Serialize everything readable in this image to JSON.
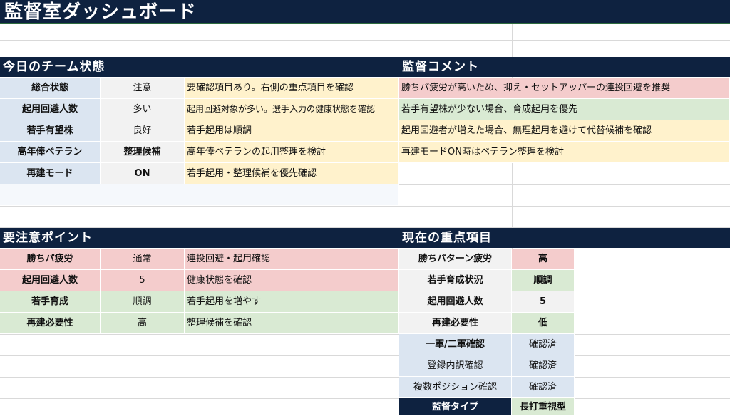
{
  "title": "監督室ダッシュボード",
  "colors": {
    "header_navy": "#0e2240",
    "pink": "#f4cccc",
    "green": "#d9ead3",
    "yellow": "#fff2cc",
    "light_blue": "#dbe5f1",
    "gray": "#f2f2f2"
  },
  "team_status": {
    "heading": "今日のチーム状態",
    "rows": [
      {
        "label": "総合状態",
        "value": "注意",
        "note": "要確認項目あり。右側の重点項目を確認"
      },
      {
        "label": "起用回避人数",
        "value": "多い",
        "note": "起用回避対象が多い。選手入力の健康状態を確認"
      },
      {
        "label": "若手有望株",
        "value": "良好",
        "note": "若手起用は順調"
      },
      {
        "label": "高年俸ベテラン",
        "value": "整理候補",
        "note": "高年俸ベテランの起用整理を検討"
      },
      {
        "label": "再建モード",
        "value": "ON",
        "note": "若手起用・整理候補を優先確認"
      }
    ]
  },
  "manager_comments": {
    "heading": "監督コメント",
    "items": [
      {
        "text": "勝ちパ疲労が高いため、抑え・セットアッパーの連投回避を推奨",
        "tone": "pink"
      },
      {
        "text": "若手有望株が少ない場合、育成起用を優先",
        "tone": "green"
      },
      {
        "text": "起用回避者が増えた場合、無理起用を避けて代替候補を確認",
        "tone": "yellow"
      },
      {
        "text": "再建モードON時はベテラン整理を検討",
        "tone": "yellow"
      }
    ]
  },
  "attention_points": {
    "heading": "要注意ポイント",
    "rows": [
      {
        "label": "勝ちパ疲労",
        "value": "通常",
        "note": "連投回避・起用確認",
        "tone": "pink"
      },
      {
        "label": "起用回避人数",
        "value": "5",
        "note": "健康状態を確認",
        "tone": "pink"
      },
      {
        "label": "若手育成",
        "value": "順調",
        "note": "若手起用を増やす",
        "tone": "green"
      },
      {
        "label": "再建必要性",
        "value": "高",
        "note": "整理候補を確認",
        "tone": "green"
      }
    ]
  },
  "focus_items": {
    "heading": "現在の重点項目",
    "rows": [
      {
        "label": "勝ちパターン疲労",
        "value": "高",
        "tone": "pink"
      },
      {
        "label": "若手育成状況",
        "value": "順調",
        "tone": "green"
      },
      {
        "label": "起用回避人数",
        "value": "5",
        "tone": "gray"
      },
      {
        "label": "再建必要性",
        "value": "低",
        "tone": "green"
      }
    ],
    "checks": [
      {
        "label": "一軍/二軍確認",
        "value": "確認済"
      },
      {
        "label": "登録内訳確認",
        "value": "確認済"
      },
      {
        "label": "複数ポジション確認",
        "value": "確認済"
      }
    ],
    "manager_type": {
      "label": "監督タイプ",
      "value": "長打重視型"
    }
  }
}
